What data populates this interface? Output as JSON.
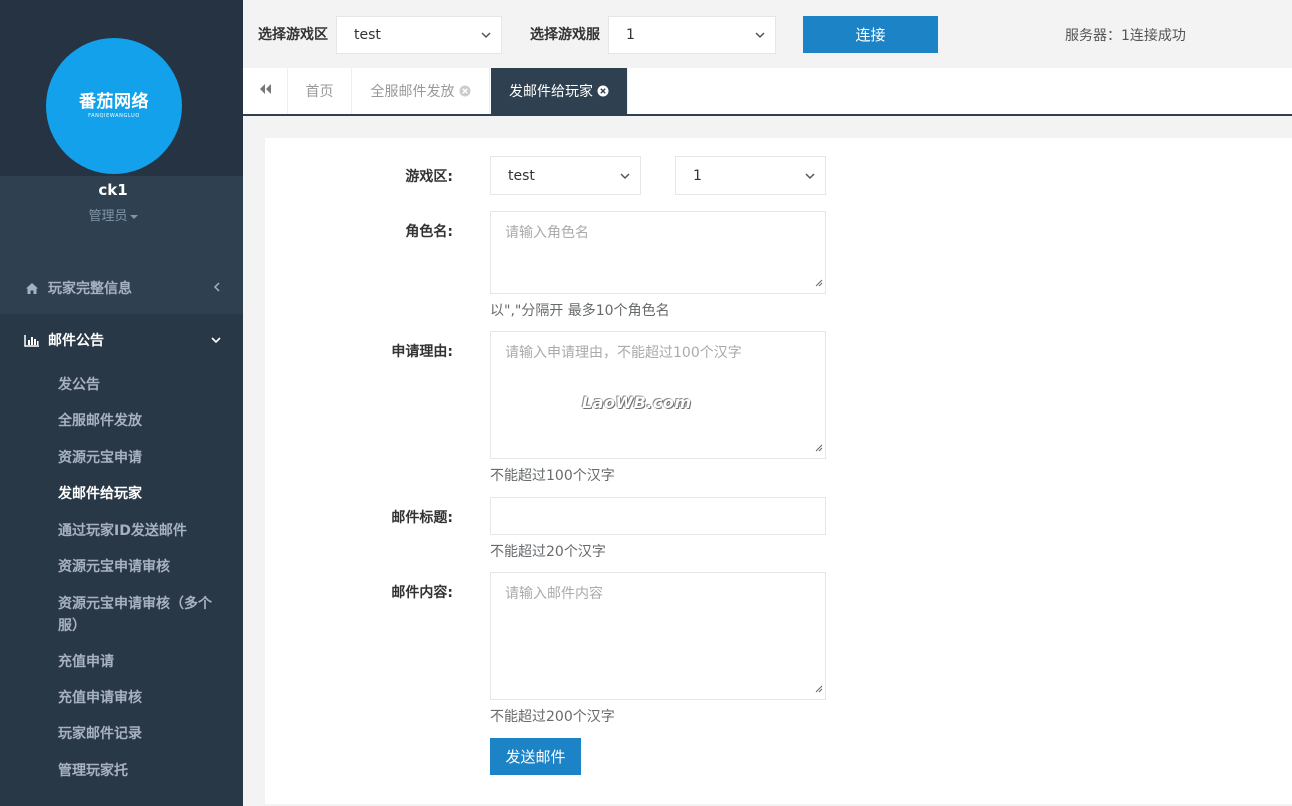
{
  "sidebar": {
    "logo": {
      "main": "番茄网络",
      "sub": "FANQIEWANGLUO"
    },
    "user": {
      "name": "ck1",
      "role": "管理员"
    },
    "nav": [
      {
        "label": "玩家完整信息",
        "icon": "home-icon"
      },
      {
        "label": "邮件公告",
        "icon": "bar-chart-icon"
      }
    ],
    "submenu": [
      "发公告",
      "全服邮件发放",
      "资源元宝申请",
      "发邮件给玩家",
      "通过玩家ID发送邮件",
      "资源元宝申请审核",
      "资源元宝申请审核（多个服）",
      "充值申请",
      "充值申请审核",
      "玩家邮件记录",
      "管理玩家托"
    ],
    "submenu_active": "发邮件给玩家"
  },
  "topbar": {
    "zone_label": "选择游戏区",
    "zone_value": "test",
    "server_label": "选择游戏服",
    "server_value": "1",
    "connect_label": "连接",
    "status_text": "服务器：1连接成功"
  },
  "tabs": [
    {
      "label": "首页",
      "closable": false,
      "active": false
    },
    {
      "label": "全服邮件发放",
      "closable": true,
      "active": false
    },
    {
      "label": "发邮件给玩家",
      "closable": true,
      "active": true
    }
  ],
  "form": {
    "zone_label": "游戏区:",
    "zone_value": "test",
    "server_value": "1",
    "role_label": "角色名:",
    "role_placeholder": "请输入角色名",
    "role_help": "以\",\"分隔开 最多10个角色名",
    "reason_label": "申请理由:",
    "reason_placeholder": "请输入申请理由，不能超过100个汉字",
    "reason_help": "不能超过100个汉字",
    "title_label": "邮件标题:",
    "title_help": "不能超过20个汉字",
    "content_label": "邮件内容:",
    "content_placeholder": "请输入邮件内容",
    "content_help": "不能超过200个汉字",
    "submit_label": "发送邮件"
  },
  "watermark": "LaoWB.com",
  "colors": {
    "sidebar": "#2f4050",
    "primary": "#1c84c6",
    "logo": "#12a1ea"
  }
}
